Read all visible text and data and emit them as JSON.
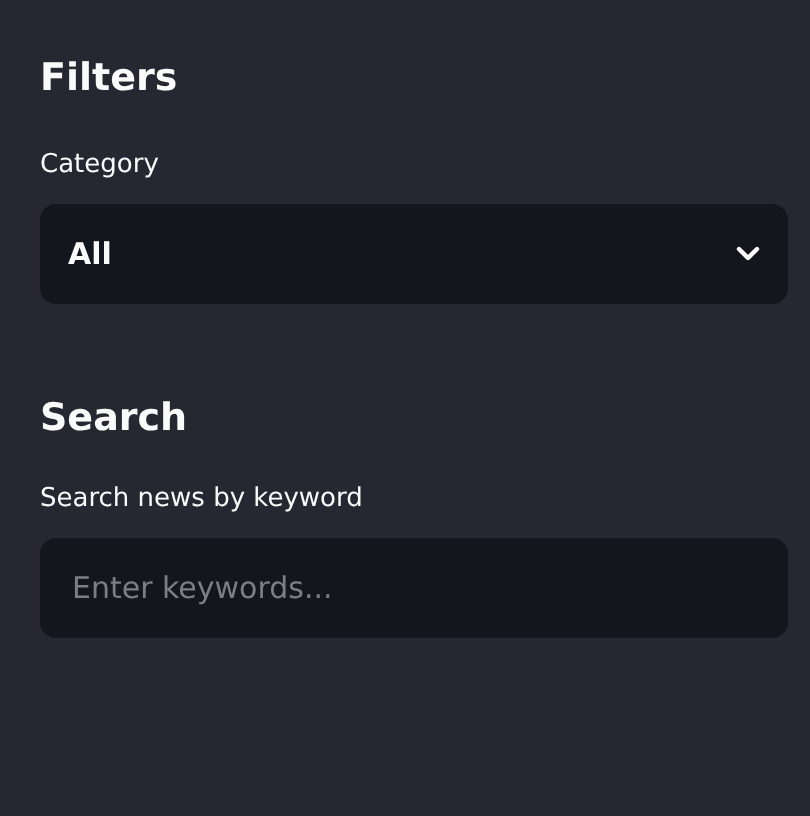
{
  "filters": {
    "title": "Filters",
    "category": {
      "label": "Category",
      "value": "All"
    }
  },
  "search": {
    "title": "Search",
    "field": {
      "label": "Search news by keyword",
      "placeholder": "Enter keywords..."
    }
  }
}
